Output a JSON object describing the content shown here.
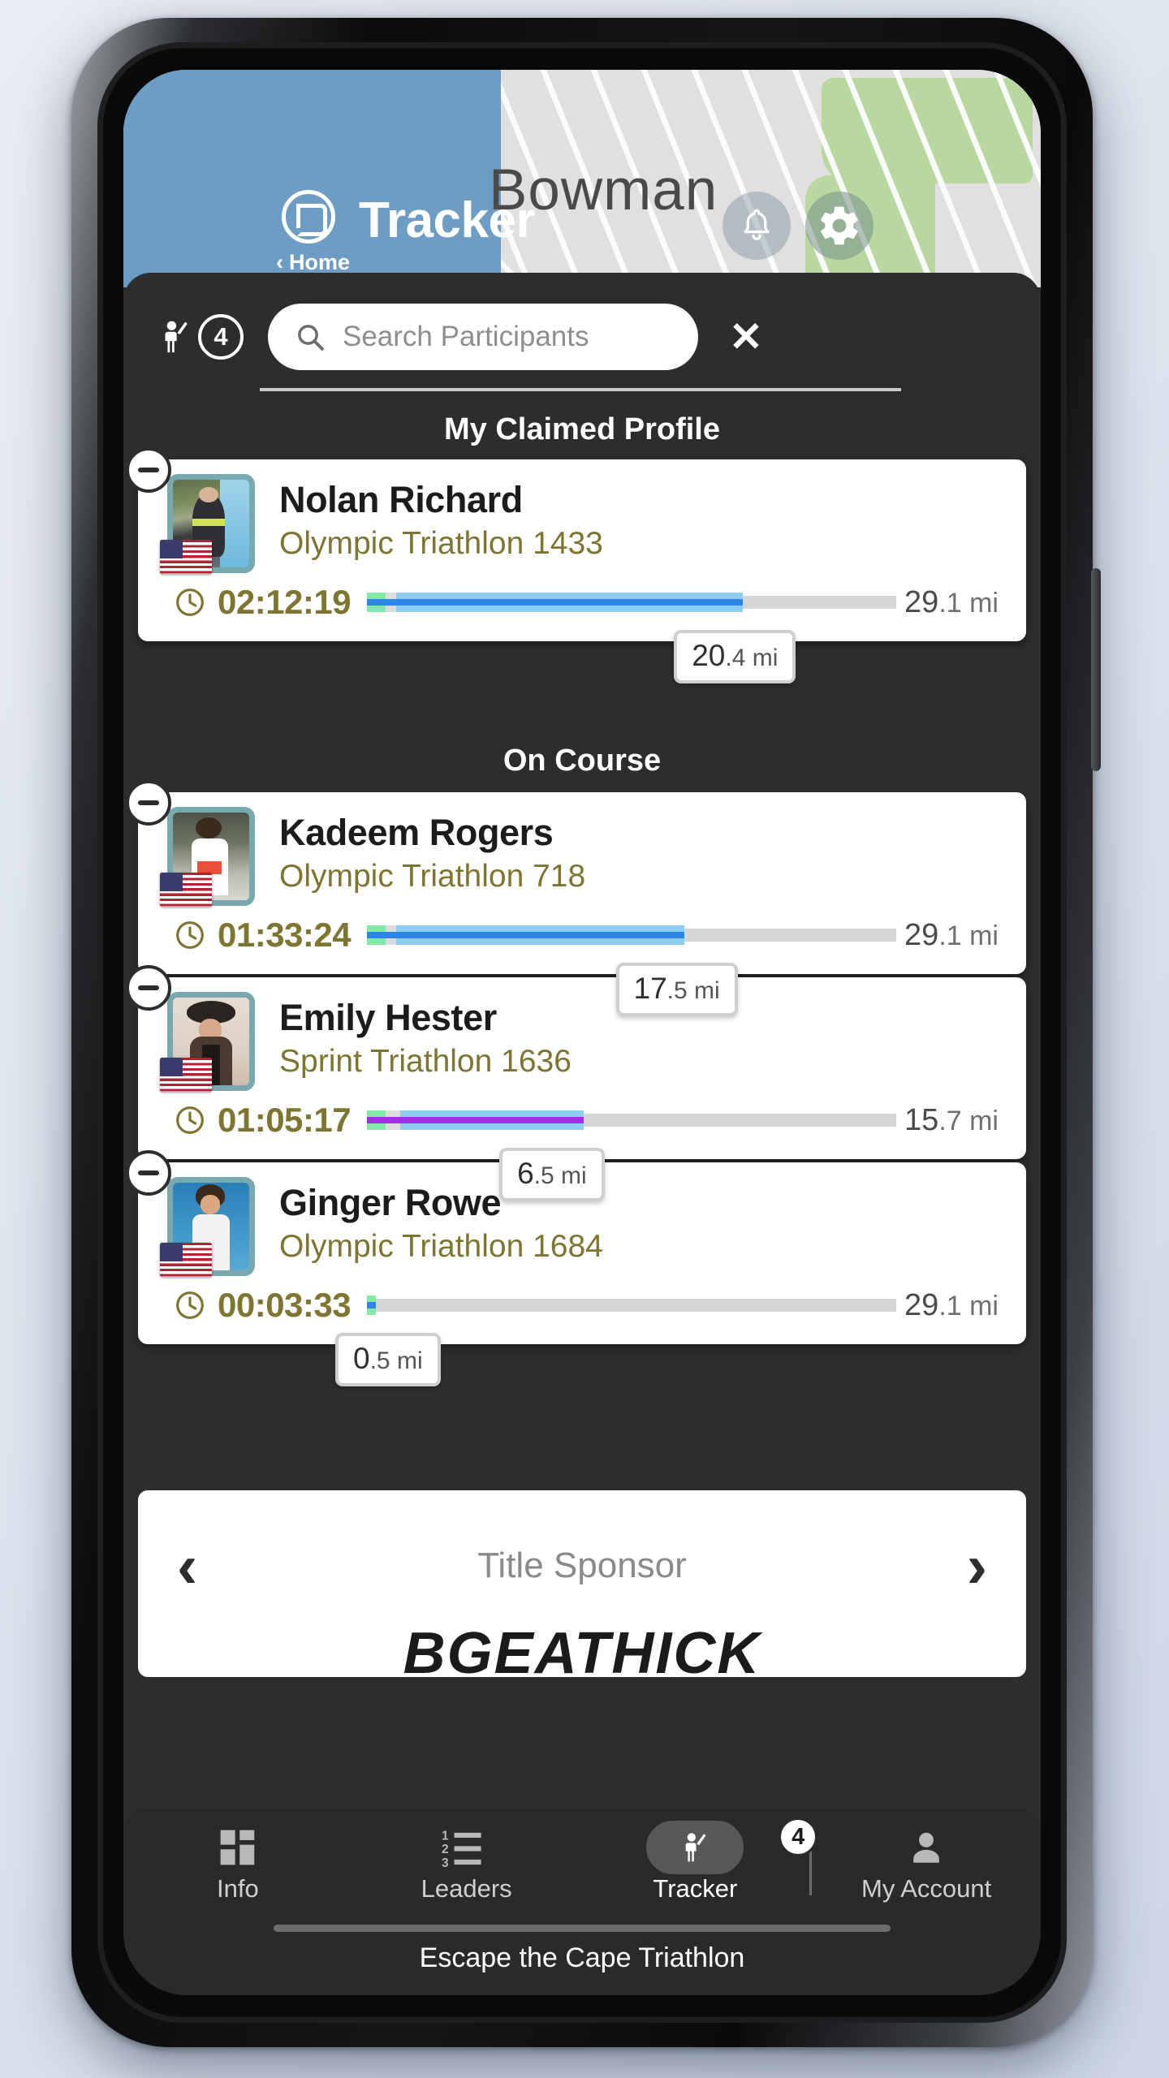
{
  "header": {
    "app_title": "Tracker",
    "back_label": "Home",
    "back_chevron": "‹",
    "logo_icon": "app-logo-icon",
    "bell_icon": "bell-icon",
    "gear_icon": "gear-icon",
    "map_label": "Bowman",
    "accent_blue": "#6d9dc5"
  },
  "search": {
    "count": "4",
    "person_icon": "person-waving-icon",
    "search_icon": "search-icon",
    "placeholder": "Search Participants",
    "close_label": "✕"
  },
  "sections": [
    {
      "id": "claimed",
      "title": "My Claimed Profile"
    },
    {
      "id": "on_course",
      "title": "On Course"
    }
  ],
  "participants": [
    {
      "name": "Nolan Richard",
      "event": "Olympic Triathlon 1433",
      "time": "02:12:19",
      "total_distance_value": "29",
      "total_distance_frac": ".1 mi",
      "current_distance_value": "20",
      "current_distance_frac": ".4 mi",
      "progress_pct": 71,
      "swim_pct": 3.5,
      "t1_pct": 2.0,
      "line_color": "#2b86e8",
      "flag": "us-flag-icon",
      "section": "claimed"
    },
    {
      "name": "Kadeem Rogers",
      "event": "Olympic Triathlon 718",
      "time": "01:33:24",
      "total_distance_value": "29",
      "total_distance_frac": ".1 mi",
      "current_distance_value": "17",
      "current_distance_frac": ".5 mi",
      "progress_pct": 60,
      "swim_pct": 3.5,
      "t1_pct": 2.0,
      "line_color": "#2b86e8",
      "flag": "us-flag-icon",
      "section": "on_course"
    },
    {
      "name": "Emily Hester",
      "event": "Sprint Triathlon 1636",
      "time": "01:05:17",
      "total_distance_value": "15",
      "total_distance_frac": ".7 mi",
      "current_distance_value": "6",
      "current_distance_frac": ".5 mi",
      "progress_pct": 41,
      "swim_pct": 3.5,
      "t1_pct": 2.8,
      "line_color": "#a32ee8",
      "flag": "us-flag-icon",
      "section": "on_course"
    },
    {
      "name": "Ginger Rowe",
      "event": "Olympic Triathlon 1684",
      "time": "00:03:33",
      "total_distance_value": "29",
      "total_distance_frac": ".1 mi",
      "current_distance_value": "0",
      "current_distance_frac": ".5 mi",
      "progress_pct": 1.7,
      "swim_pct": 1.7,
      "t1_pct": 0,
      "line_color": "#2b86e8",
      "flag": "us-flag-icon",
      "section": "on_course"
    }
  ],
  "sponsor": {
    "title": "Title Sponsor",
    "brand": "BGEATHICK",
    "prev_label": "‹",
    "next_label": "›"
  },
  "tabs": [
    {
      "label": "Info",
      "icon": "grid-tiles-icon",
      "active": false
    },
    {
      "label": "Leaders",
      "icon": "numbered-list-icon",
      "active": false
    },
    {
      "label": "Tracker",
      "icon": "person-waving-icon",
      "active": true,
      "badge": "4"
    },
    {
      "label": "My Account",
      "icon": "person-account-icon",
      "active": false
    }
  ],
  "footer": {
    "event_name": "Escape the Cape Triathlon"
  }
}
